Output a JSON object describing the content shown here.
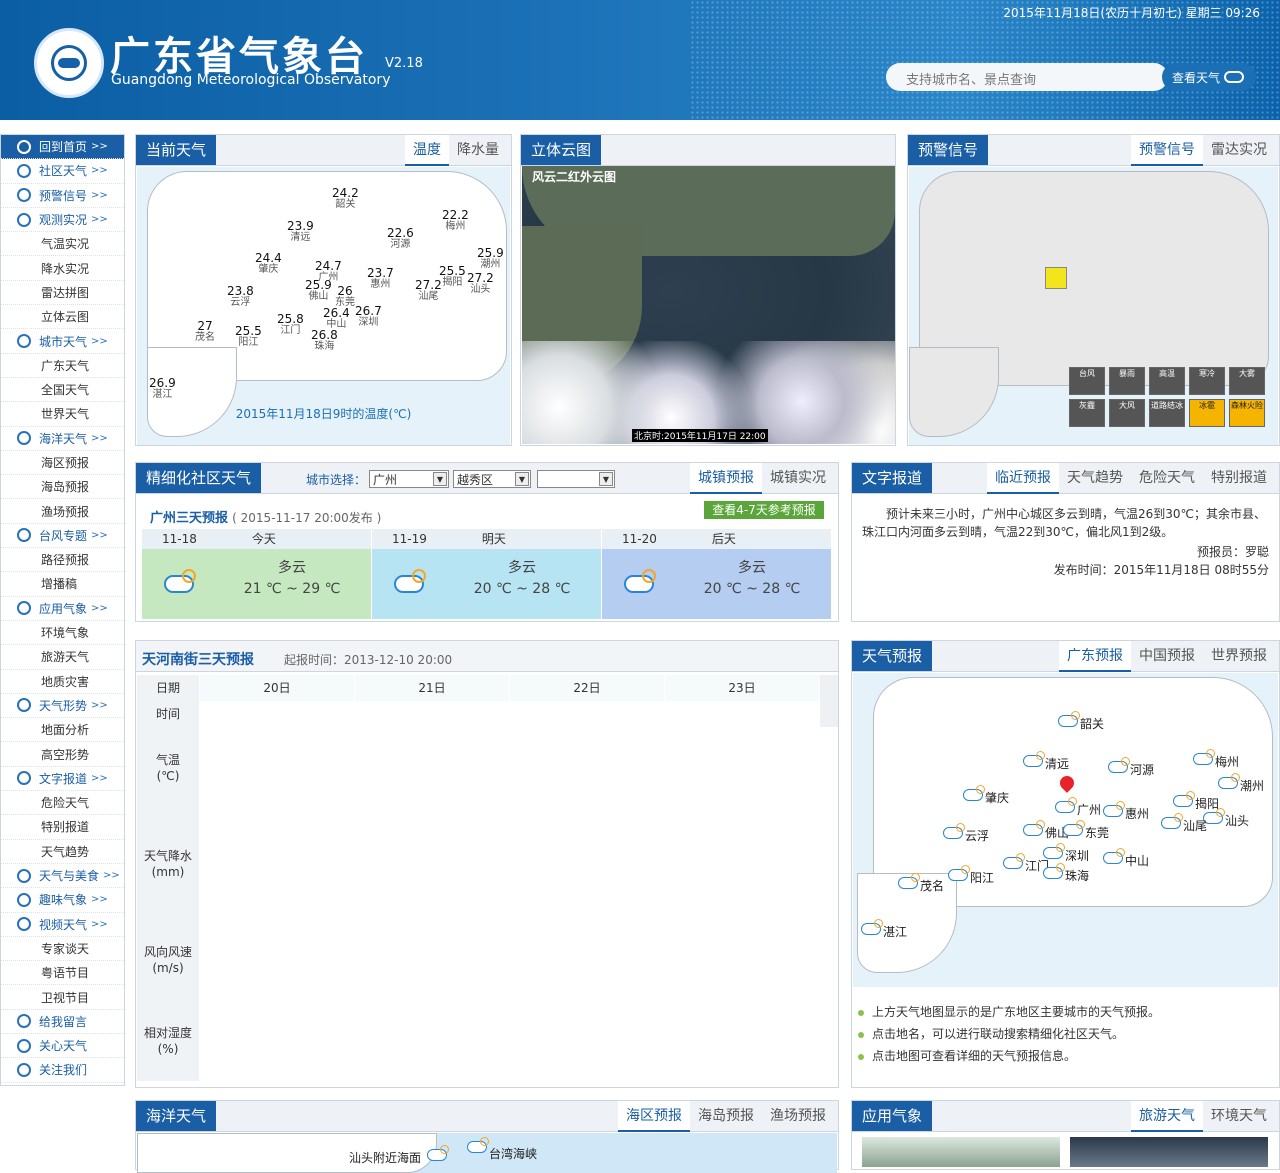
{
  "header": {
    "title_cn": "广东省气象台",
    "title_en": "Guangdong Meteorological Observatory",
    "version": "V2.18",
    "datetime": "2015年11月18日(农历十月初七) 星期三 09:26",
    "search_placeholder": "支持城市名、景点查询",
    "search_button": "查看天气"
  },
  "sidebar": [
    {
      "label": "回到首页",
      "type": "head",
      "arrow": ">>",
      "active": true
    },
    {
      "label": "社区天气",
      "type": "head",
      "arrow": ">>"
    },
    {
      "label": "预警信号",
      "type": "head",
      "arrow": ">>"
    },
    {
      "label": "观测实况",
      "type": "head",
      "arrow": ">>"
    },
    {
      "label": "气温实况",
      "type": "sub"
    },
    {
      "label": "降水实况",
      "type": "sub"
    },
    {
      "label": "雷达拼图",
      "type": "sub"
    },
    {
      "label": "立体云图",
      "type": "sub"
    },
    {
      "label": "城市天气",
      "type": "head",
      "arrow": ">>"
    },
    {
      "label": "广东天气",
      "type": "sub"
    },
    {
      "label": "全国天气",
      "type": "sub"
    },
    {
      "label": "世界天气",
      "type": "sub"
    },
    {
      "label": "海洋天气",
      "type": "head",
      "arrow": ">>"
    },
    {
      "label": "海区预报",
      "type": "sub"
    },
    {
      "label": "海岛预报",
      "type": "sub"
    },
    {
      "label": "渔场预报",
      "type": "sub"
    },
    {
      "label": "台风专题",
      "type": "head",
      "arrow": ">>"
    },
    {
      "label": "路径预报",
      "type": "sub"
    },
    {
      "label": "增播稿",
      "type": "sub"
    },
    {
      "label": "应用气象",
      "type": "head",
      "arrow": ">>"
    },
    {
      "label": "环境气象",
      "type": "sub"
    },
    {
      "label": "旅游天气",
      "type": "sub"
    },
    {
      "label": "地质灾害",
      "type": "sub"
    },
    {
      "label": "天气形势",
      "type": "head",
      "arrow": ">>"
    },
    {
      "label": "地面分析",
      "type": "sub"
    },
    {
      "label": "高空形势",
      "type": "sub"
    },
    {
      "label": "文字报道",
      "type": "head",
      "arrow": ">>"
    },
    {
      "label": "危险天气",
      "type": "sub"
    },
    {
      "label": "特别报道",
      "type": "sub"
    },
    {
      "label": "天气趋势",
      "type": "sub"
    },
    {
      "label": "天气与美食",
      "type": "head",
      "arrow": ">>"
    },
    {
      "label": "趣味气象",
      "type": "head",
      "arrow": ">>"
    },
    {
      "label": "视频天气",
      "type": "head",
      "arrow": ">>"
    },
    {
      "label": "专家谈天",
      "type": "sub"
    },
    {
      "label": "粤语节目",
      "type": "sub"
    },
    {
      "label": "卫视节目",
      "type": "sub"
    },
    {
      "label": "给我留言",
      "type": "head",
      "arrow": ""
    },
    {
      "label": "关心天气",
      "type": "head",
      "arrow": ""
    },
    {
      "label": "关注我们",
      "type": "head",
      "arrow": ""
    }
  ],
  "current": {
    "title": "当前天气",
    "tabs": [
      "温度",
      "降水量"
    ],
    "caption": "2015年11月18日9时的温度(℃)",
    "stations": [
      {
        "v": "24.2",
        "n": "韶关"
      },
      {
        "v": "23.9",
        "n": "清远"
      },
      {
        "v": "22.6",
        "n": "河源"
      },
      {
        "v": "22.2",
        "n": "梅州"
      },
      {
        "v": "25.9",
        "n": "潮州"
      },
      {
        "v": "24.4",
        "n": "肇庆"
      },
      {
        "v": "24.7",
        "n": "广州"
      },
      {
        "v": "23.7",
        "n": "惠州"
      },
      {
        "v": "25.5",
        "n": "揭阳"
      },
      {
        "v": "27.2",
        "n": "汕头"
      },
      {
        "v": "27.2",
        "n": "汕尾"
      },
      {
        "v": "23.8",
        "n": "云浮"
      },
      {
        "v": "25.9",
        "n": "佛山"
      },
      {
        "v": "26",
        "n": "东莞"
      },
      {
        "v": "26.7",
        "n": "深圳"
      },
      {
        "v": "26.4",
        "n": "中山"
      },
      {
        "v": "25.8",
        "n": "江门"
      },
      {
        "v": "27",
        "n": "茂名"
      },
      {
        "v": "25.5",
        "n": "阳江"
      },
      {
        "v": "26.8",
        "n": "珠海"
      },
      {
        "v": "26.9",
        "n": "湛江"
      }
    ]
  },
  "satellite": {
    "title": "立体云图",
    "caption": "风云二红外云图",
    "time": "北京时:2015年11月17日 22:00"
  },
  "warning": {
    "title": "预警信号",
    "tabs": [
      "预警信号",
      "雷达实况"
    ],
    "signals": [
      "台风",
      "暴雨",
      "高温",
      "寒冷",
      "大雾",
      "灰霾",
      "大风",
      "道路结冰",
      "冰雹",
      "森林火险"
    ]
  },
  "community": {
    "title": "精细化社区天气",
    "city_label": "城市选择：",
    "city": "广州",
    "district": "越秀区",
    "street": "",
    "tabs": [
      "城镇预报",
      "城镇实况"
    ],
    "forecast_title": "广州三天预报",
    "forecast_time": "( 2015-11-17 20:00发布 )",
    "more_button": "查看4-7天参考预报",
    "days": [
      {
        "date": "11-18",
        "label": "今天",
        "desc": "多云",
        "temp": "21 ℃ ~ 29 ℃",
        "bg": "#c6e8c0"
      },
      {
        "date": "11-19",
        "label": "明天",
        "desc": "多云",
        "temp": "20 ℃ ~ 28 ℃",
        "bg": "#b6e4f2"
      },
      {
        "date": "11-20",
        "label": "后天",
        "desc": "多云",
        "temp": "20 ℃ ~ 28 ℃",
        "bg": "#b5cdf0"
      }
    ]
  },
  "text_report": {
    "title": "文字报道",
    "tabs": [
      "临近预报",
      "天气趋势",
      "危险天气",
      "特别报道"
    ],
    "body": "预计未来三小时，广州中心城区多云到晴，气温26到30℃；其余市县、珠江口内河面多云到晴，气温22到30℃，偏北风1到2级。",
    "reporter": "预报员：罗聪",
    "publish": "发布时间：2015年11月18日 08时55分"
  },
  "street": {
    "title": "天河南街三天预报",
    "time": "起报时间：2013-12-10 20:00",
    "dates": [
      "20日",
      "21日",
      "22日",
      "23日"
    ],
    "rows": [
      "日期",
      "时间",
      "气温\n(℃)",
      "天气降水\n(mm)",
      "风向风速\n(m/s)",
      "相对湿度\n(%)"
    ]
  },
  "province": {
    "title": "天气预报",
    "tabs": [
      "广东预报",
      "中国预报",
      "世界预报"
    ],
    "cities": [
      "韶关",
      "清远",
      "河源",
      "梅州",
      "潮州",
      "肇庆",
      "广州",
      "惠州",
      "揭阳",
      "汕头",
      "汕尾",
      "云浮",
      "佛山",
      "东莞",
      "中山",
      "深圳",
      "江门",
      "珠海",
      "茂名",
      "阳江",
      "湛江"
    ],
    "notes": [
      "上方天气地图显示的是广东地区主要城市的天气预报。",
      "点击地名，可以进行联动搜索精细化社区天气。",
      "点击地图可查看详细的天气预报信息。"
    ]
  },
  "ocean": {
    "title": "海洋天气",
    "tabs": [
      "海区预报",
      "海岛预报",
      "渔场预报"
    ],
    "labels": [
      "汕头附近海面",
      "台湾海峡"
    ]
  },
  "applied": {
    "title": "应用气象",
    "tabs": [
      "旅游天气",
      "环境天气"
    ]
  }
}
